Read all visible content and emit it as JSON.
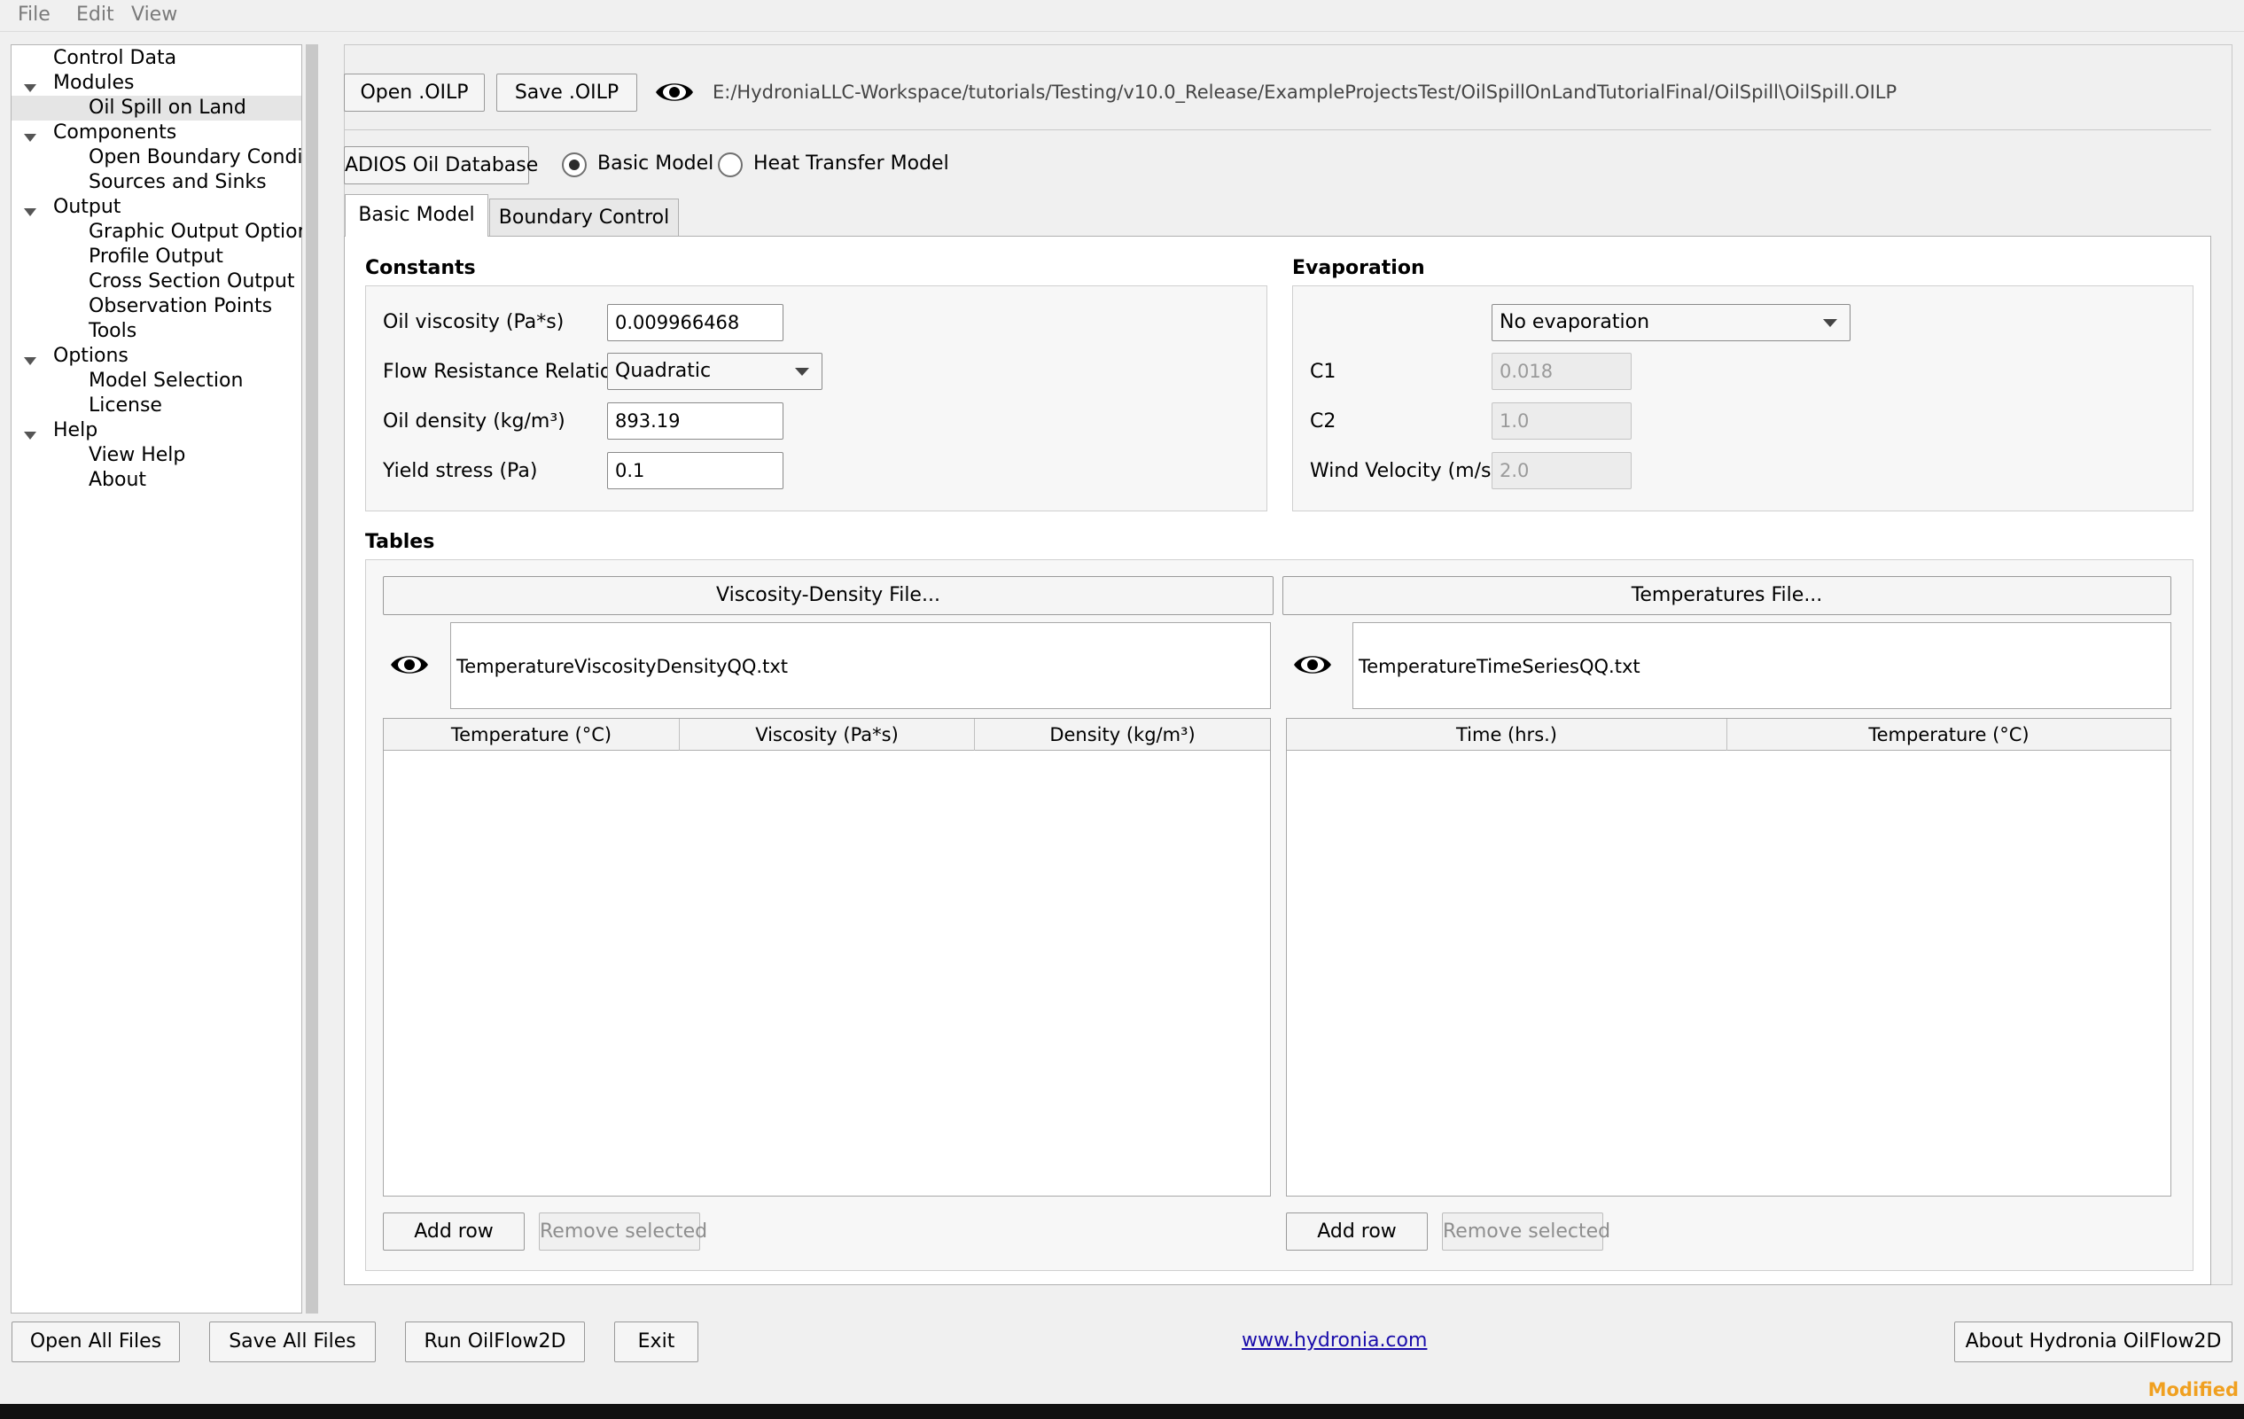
{
  "menu": {
    "file": "File",
    "edit": "Edit",
    "view": "View"
  },
  "tree": {
    "control_data": "Control Data",
    "modules": "Modules",
    "oil_spill_on_land": "Oil Spill on Land",
    "components": "Components",
    "open_boundary": "Open Boundary Condi...",
    "sources_sinks": "Sources and Sinks",
    "output": "Output",
    "graphic_output": "Graphic Output Options",
    "profile_output": "Profile Output",
    "cross_section": "Cross Section Output",
    "observation_points": "Observation Points",
    "tools": "Tools",
    "options": "Options",
    "model_selection": "Model Selection",
    "license": "License",
    "help": "Help",
    "view_help": "View Help",
    "about": "About"
  },
  "toolbar": {
    "open_label": "Open .OILP",
    "save_label": "Save .OILP",
    "file_path": "E:/HydroniaLLC-Workspace/tutorials/Testing/v10.0_Release/ExampleProjectsTest/OilSpillOnLandTutorialFinal/OilSpill\\OilSpill.OILP"
  },
  "model_row": {
    "adios_label": "ADIOS Oil Database",
    "basic_model_label": "Basic Model",
    "heat_transfer_label": "Heat Transfer Model",
    "selected": "Basic Model"
  },
  "tabs": {
    "basic_model": "Basic Model",
    "boundary_control": "Boundary Control"
  },
  "constants": {
    "title": "Constants",
    "viscosity_label": "Oil viscosity (Pa*s)",
    "viscosity_value": "0.009966468",
    "flow_resistance_label": "Flow Resistance Relation",
    "flow_resistance_value": "Quadratic",
    "density_label": "Oil density (kg/m³)",
    "density_value": "893.19",
    "yield_label": "Yield stress (Pa)",
    "yield_value": "0.1"
  },
  "evaporation": {
    "title": "Evaporation",
    "mode_value": "No evaporation",
    "c1_label": "C1",
    "c1_value": "0.018",
    "c2_label": "C2",
    "c2_value": "1.0",
    "wind_label": "Wind Velocity (m/s)",
    "wind_value": "2.0"
  },
  "tables": {
    "title": "Tables",
    "left": {
      "file_button": "Viscosity-Density File...",
      "file_name": "TemperatureViscosityDensityQQ.txt",
      "columns": [
        "Temperature (°C)",
        "Viscosity (Pa*s)",
        "Density (kg/m³)"
      ],
      "add_row": "Add row",
      "remove_selected": "Remove selected"
    },
    "right": {
      "file_button": "Temperatures File...",
      "file_name": "TemperatureTimeSeriesQQ.txt",
      "columns": [
        "Time (hrs.)",
        "Temperature (°C)"
      ],
      "add_row": "Add row",
      "remove_selected": "Remove selected"
    }
  },
  "bottom": {
    "open_all": "Open All Files",
    "save_all": "Save All Files",
    "run": "Run OilFlow2D",
    "exit": "Exit",
    "website": "www.hydronia.com",
    "about": "About Hydronia OilFlow2D",
    "status": "Modified"
  },
  "colors": {
    "status_modified": "#f0a020",
    "link": "#1a0dab"
  }
}
